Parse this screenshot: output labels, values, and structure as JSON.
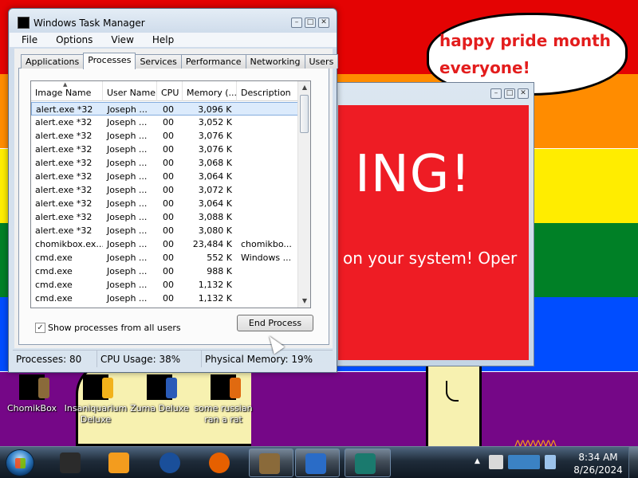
{
  "wallpaper": {
    "stripes": [
      "#e40303",
      "#ff8c00",
      "#ffed00",
      "#008026",
      "#004dff",
      "#750787"
    ],
    "speech_bubble": "happy pride month everyone!"
  },
  "desktop_icons": [
    {
      "label": "ChomikBox",
      "accent": "#8a6a3a"
    },
    {
      "label": "Insaniquarium Deluxe",
      "accent": "#f2b21b"
    },
    {
      "label": "Zuma Deluxe",
      "accent": "#2a5bb8"
    },
    {
      "label": "some russian ran a rat",
      "accent": "#e06a10"
    }
  ],
  "alert_window": {
    "big_text": "ING!",
    "small_text": "on your system! Oper",
    "background": "#ee1c24"
  },
  "task_manager": {
    "title": "Windows Task Manager",
    "menu": [
      "File",
      "Options",
      "View",
      "Help"
    ],
    "tabs": [
      "Applications",
      "Processes",
      "Services",
      "Performance",
      "Networking",
      "Users"
    ],
    "active_tab": "Processes",
    "columns": [
      "Image Name",
      "User Name",
      "CPU",
      "Memory (...",
      "Description"
    ],
    "processes": [
      {
        "image": "alert.exe *32",
        "user": "Joseph ...",
        "cpu": "00",
        "memory": "3,096 K",
        "description": ""
      },
      {
        "image": "alert.exe *32",
        "user": "Joseph ...",
        "cpu": "00",
        "memory": "3,052 K",
        "description": ""
      },
      {
        "image": "alert.exe *32",
        "user": "Joseph ...",
        "cpu": "00",
        "memory": "3,076 K",
        "description": ""
      },
      {
        "image": "alert.exe *32",
        "user": "Joseph ...",
        "cpu": "00",
        "memory": "3,076 K",
        "description": ""
      },
      {
        "image": "alert.exe *32",
        "user": "Joseph ...",
        "cpu": "00",
        "memory": "3,068 K",
        "description": ""
      },
      {
        "image": "alert.exe *32",
        "user": "Joseph ...",
        "cpu": "00",
        "memory": "3,064 K",
        "description": ""
      },
      {
        "image": "alert.exe *32",
        "user": "Joseph ...",
        "cpu": "00",
        "memory": "3,072 K",
        "description": ""
      },
      {
        "image": "alert.exe *32",
        "user": "Joseph ...",
        "cpu": "00",
        "memory": "3,064 K",
        "description": ""
      },
      {
        "image": "alert.exe *32",
        "user": "Joseph ...",
        "cpu": "00",
        "memory": "3,088 K",
        "description": ""
      },
      {
        "image": "alert.exe *32",
        "user": "Joseph ...",
        "cpu": "00",
        "memory": "3,080 K",
        "description": ""
      },
      {
        "image": "chomikbox.ex...",
        "user": "Joseph ...",
        "cpu": "00",
        "memory": "23,484 K",
        "description": "chomikbo..."
      },
      {
        "image": "cmd.exe",
        "user": "Joseph ...",
        "cpu": "00",
        "memory": "552 K",
        "description": "Windows ..."
      },
      {
        "image": "cmd.exe",
        "user": "Joseph ...",
        "cpu": "00",
        "memory": "988 K",
        "description": ""
      },
      {
        "image": "cmd.exe",
        "user": "Joseph ...",
        "cpu": "00",
        "memory": "1,132 K",
        "description": ""
      },
      {
        "image": "cmd.exe",
        "user": "Joseph ...",
        "cpu": "00",
        "memory": "1,132 K",
        "description": ""
      }
    ],
    "selected_row": 0,
    "show_all_users": {
      "label": "Show processes from all users",
      "checked": true
    },
    "end_process_label": "End Process",
    "status": {
      "processes": "Processes: 80",
      "cpu": "CPU Usage: 38%",
      "memory": "Physical Memory: 19%"
    }
  },
  "taskbar": {
    "items": [
      {
        "name": "taskbar-item-cmd",
        "color": "#2b2b2b",
        "open": false
      },
      {
        "name": "taskbar-item-media-player",
        "color": "#f39c1e",
        "open": false
      },
      {
        "name": "taskbar-item-globe",
        "color": "#1a4f9a",
        "open": false
      },
      {
        "name": "taskbar-item-firefox",
        "color": "#e66000",
        "open": false
      },
      {
        "name": "taskbar-item-chomikbox",
        "color": "#8a6a3a",
        "open": true
      },
      {
        "name": "taskbar-item-powershell",
        "color": "#2a6cc7",
        "open": true
      },
      {
        "name": "taskbar-item-task-manager",
        "color": "#1a7a6e",
        "open": true
      }
    ],
    "clock_time": "8:34 AM",
    "clock_date": "8/26/2024"
  }
}
